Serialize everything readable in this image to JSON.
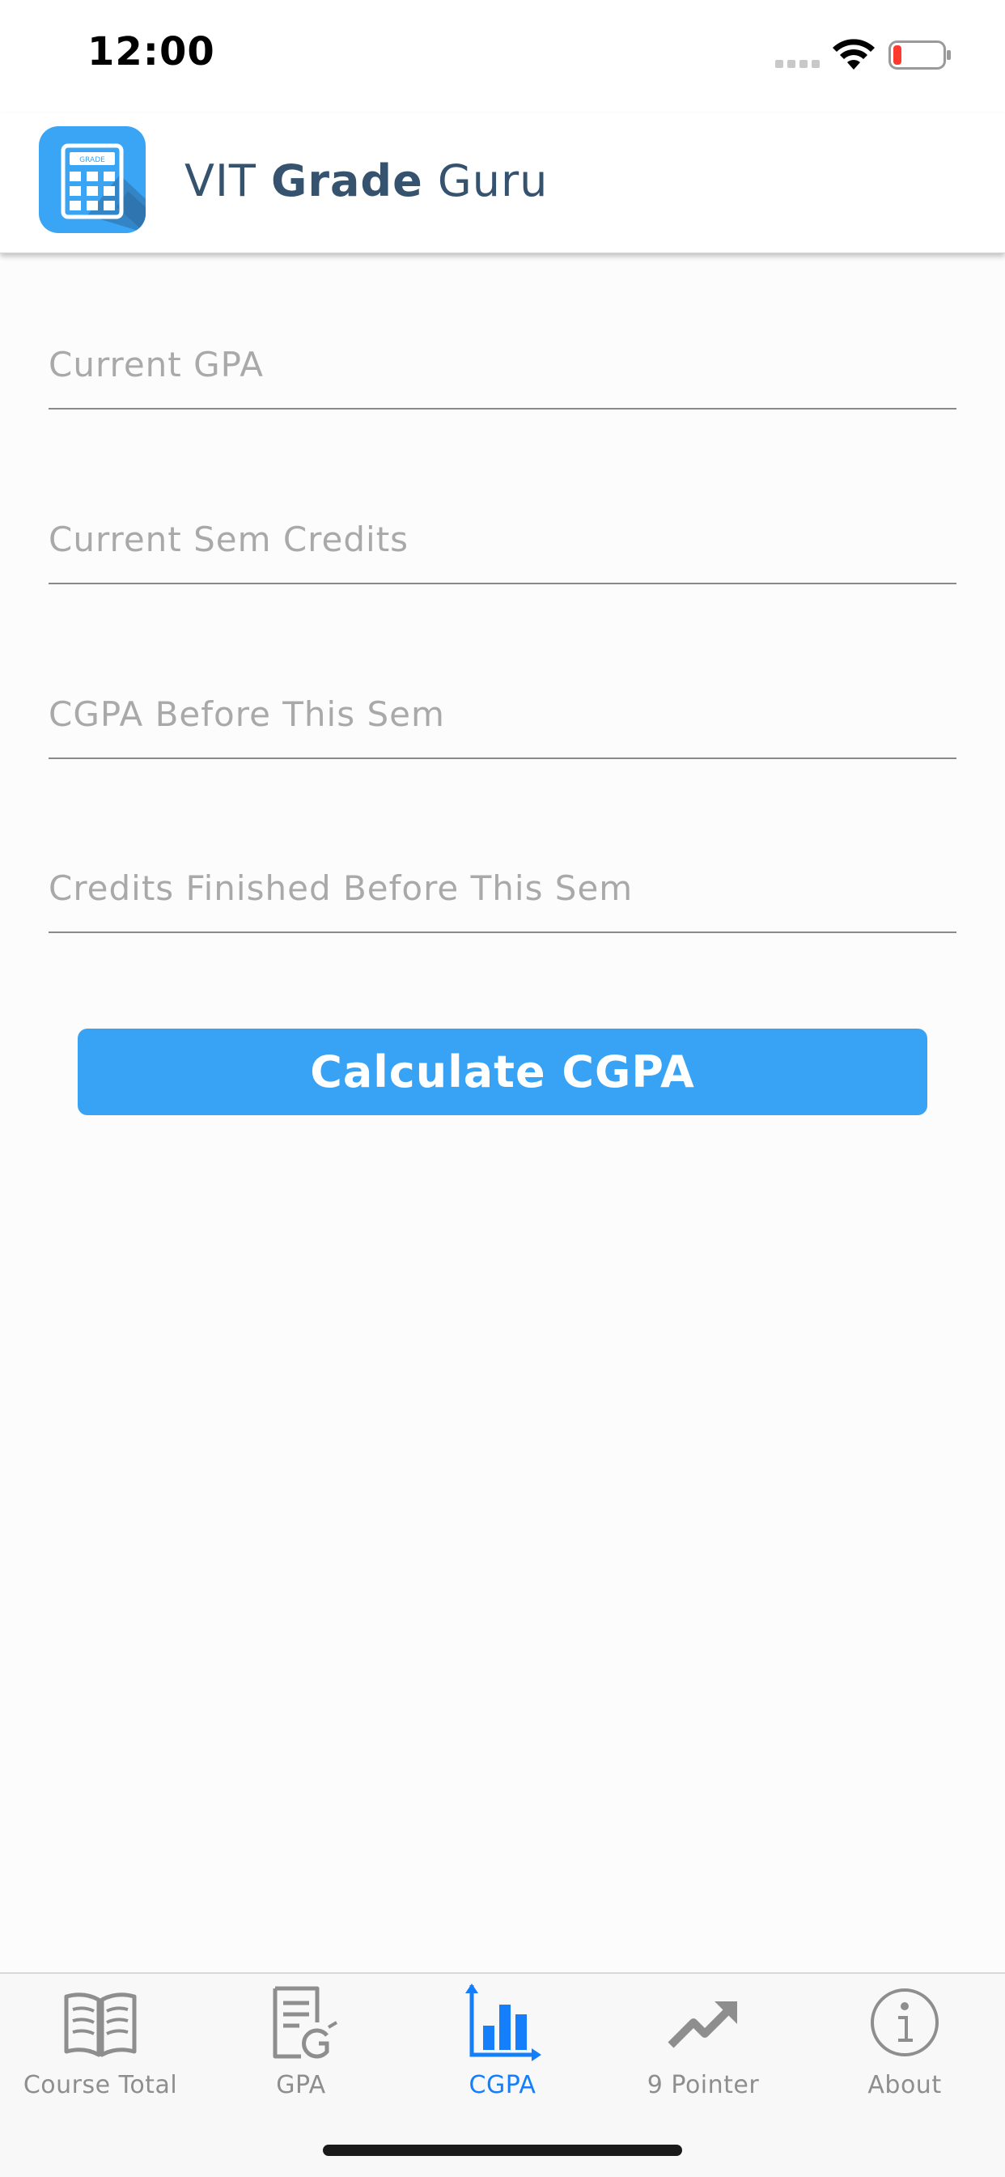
{
  "status_bar": {
    "time": "12:00"
  },
  "header": {
    "logo_text": "GRADE",
    "title_prefix": "VIT ",
    "title_bold": "Grade",
    "title_suffix": " Guru"
  },
  "form": {
    "current_gpa": {
      "value": "",
      "placeholder": "Current GPA"
    },
    "current_sem_credits": {
      "value": "",
      "placeholder": "Current Sem Credits"
    },
    "cgpa_before": {
      "value": "",
      "placeholder": "CGPA Before This Sem"
    },
    "credits_before": {
      "value": "",
      "placeholder": "Credits Finished Before This Sem"
    },
    "calculate_label": "Calculate CGPA"
  },
  "tabs": [
    {
      "label": "Course Total",
      "icon": "book-icon",
      "active": false
    },
    {
      "label": "GPA",
      "icon": "document-g-icon",
      "active": false
    },
    {
      "label": "CGPA",
      "icon": "bar-chart-icon",
      "active": true
    },
    {
      "label": "9 Pointer",
      "icon": "trending-up-icon",
      "active": false
    },
    {
      "label": "About",
      "icon": "info-icon",
      "active": false
    }
  ],
  "colors": {
    "accent": "#147efb",
    "button": "#38a3f5",
    "title": "#35526f",
    "inactive_tab": "#8e8e8e",
    "battery_low": "#ff3b30"
  }
}
